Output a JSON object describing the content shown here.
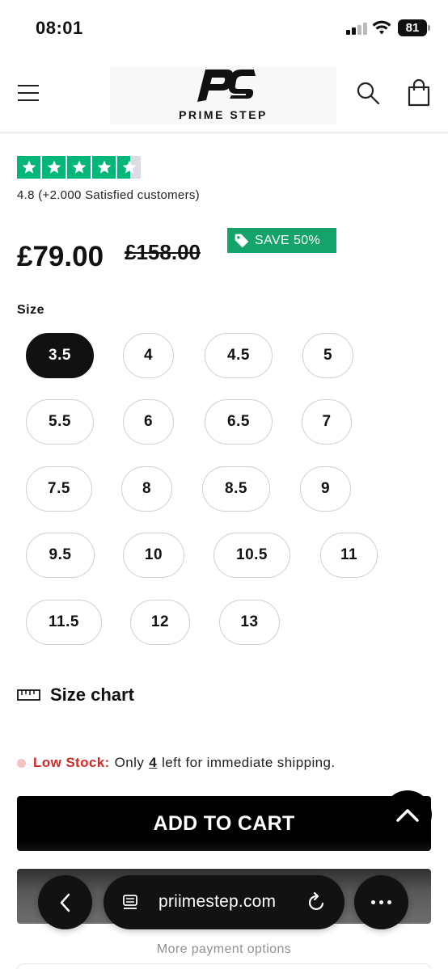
{
  "status_bar": {
    "time": "08:01",
    "battery": "81"
  },
  "header": {
    "logo_text": "PRIME STEP",
    "icons": [
      "menu-icon",
      "search-icon",
      "shopping-bag-icon"
    ]
  },
  "rating": {
    "stars": 4.8,
    "text": "4.8 (+2.000 Satisfied customers)"
  },
  "price": {
    "current": "£79.00",
    "compare_at": "£158.00",
    "badge": "SAVE 50%"
  },
  "size": {
    "label": "Size",
    "selected": "3.5",
    "options": [
      "3.5",
      "4",
      "4.5",
      "5",
      "5.5",
      "6",
      "6.5",
      "7",
      "7.5",
      "8",
      "8.5",
      "9",
      "9.5",
      "10",
      "10.5",
      "11",
      "11.5",
      "12",
      "13"
    ]
  },
  "size_chart": {
    "label": "Size chart"
  },
  "stock": {
    "label": "Low Stock:",
    "prefix": "Only",
    "count": "4",
    "suffix": "left for immediate shipping."
  },
  "buttons": {
    "add_to_cart": "ADD TO CART",
    "more_payment": "More payment options"
  },
  "browser": {
    "url": "priimestep.com"
  },
  "colors": {
    "trustpilot_green": "#00b67a",
    "save_badge": "#14a36b",
    "low_stock_red": "#d22a2a",
    "primary_button": "#000000"
  }
}
